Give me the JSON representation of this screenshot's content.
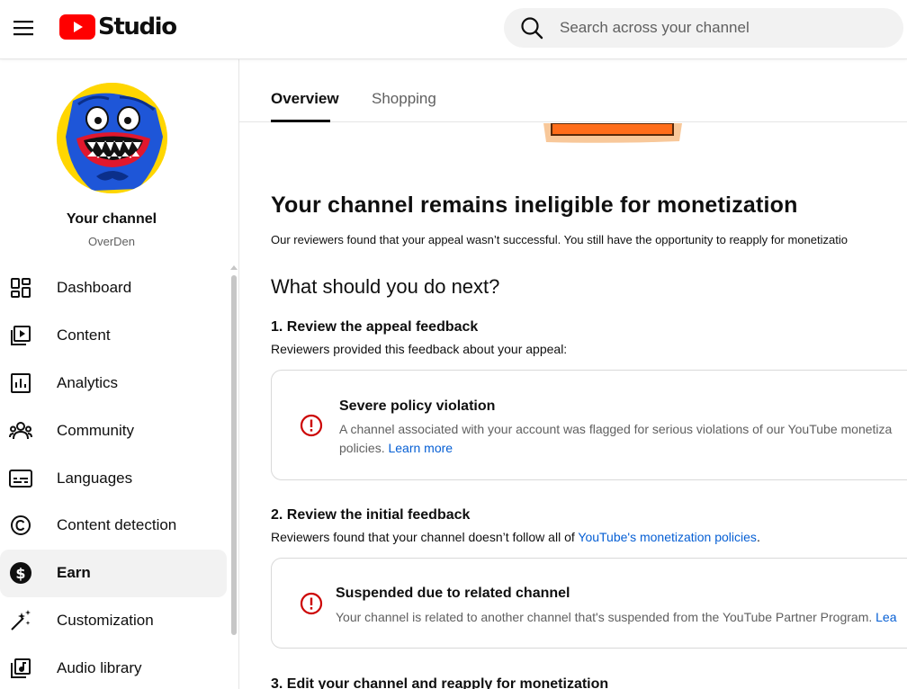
{
  "header": {
    "logo_text": "Studio",
    "search_placeholder": "Search across your channel"
  },
  "sidebar": {
    "channel_title": "Your channel",
    "channel_handle": "OverDen",
    "items": [
      {
        "label": "Dashboard",
        "icon": "dashboard-icon",
        "active": false
      },
      {
        "label": "Content",
        "icon": "content-icon",
        "active": false
      },
      {
        "label": "Analytics",
        "icon": "analytics-icon",
        "active": false
      },
      {
        "label": "Community",
        "icon": "community-icon",
        "active": false
      },
      {
        "label": "Languages",
        "icon": "subtitles-icon",
        "active": false
      },
      {
        "label": "Content detection",
        "icon": "copyright-icon",
        "active": false
      },
      {
        "label": "Earn",
        "icon": "dollar-icon",
        "active": true
      },
      {
        "label": "Customization",
        "icon": "magic-wand-icon",
        "active": false
      },
      {
        "label": "Audio library",
        "icon": "audio-library-icon",
        "active": false
      }
    ]
  },
  "tabs": [
    {
      "label": "Overview",
      "active": true
    },
    {
      "label": "Shopping",
      "active": false
    }
  ],
  "main": {
    "heading": "Your channel remains ineligible for monetization",
    "subtext": "Our reviewers found that your appeal wasn’t successful. You still have the opportunity to reapply for monetizatio",
    "next_heading": "What should you do next?",
    "step1": {
      "title": "1. Review the appeal feedback",
      "sub": "Reviewers provided this feedback about your appeal:",
      "card": {
        "title": "Severe policy violation",
        "body_line1": "A channel associated with your account was flagged for serious violations of our YouTube monetiza",
        "body_line2": "policies.",
        "link": "Learn more"
      }
    },
    "step2": {
      "title": "2. Review the initial feedback",
      "sub_prefix": "Reviewers found that your channel doesn’t follow all of",
      "sub_link": "YouTube's monetization policies",
      "sub_suffix": ".",
      "card": {
        "title": "Suspended due to related channel",
        "body": "Your channel is related to another channel that's suspended from the YouTube Partner Program.",
        "link": "Lea"
      }
    },
    "step3": {
      "title": "3. Edit your channel and reapply for monetization"
    }
  },
  "colors": {
    "brand_red": "#ff0000",
    "alert_red": "#cc0000",
    "link_blue": "#065fd4",
    "avatar_yellow": "#ffd600"
  }
}
